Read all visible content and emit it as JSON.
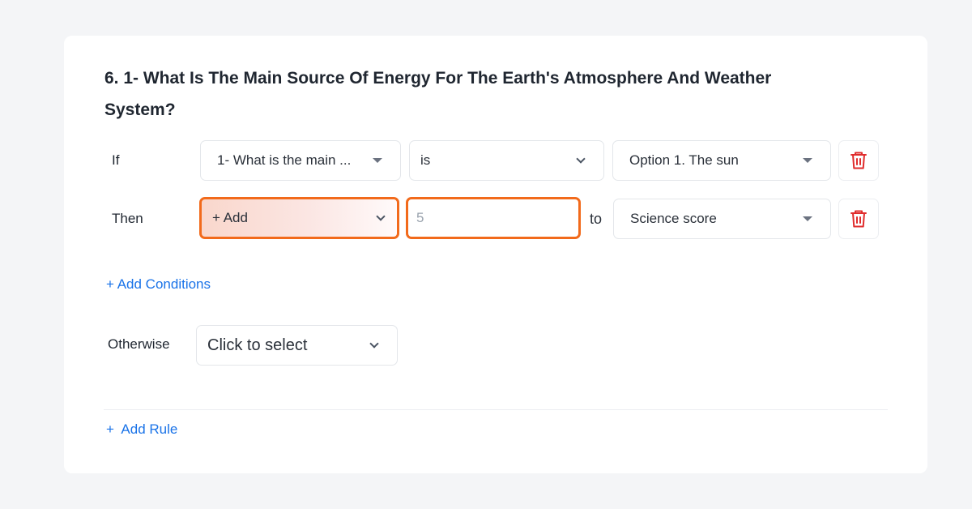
{
  "question": {
    "title": "6. 1- What Is The Main Source Of Energy For The Earth's Atmosphere And Weather System?"
  },
  "if_row": {
    "label": "If",
    "question_select": "1- What is the main ...",
    "operator_select": "is",
    "value_select": "Option 1. The sun"
  },
  "then_row": {
    "label": "Then",
    "action_select": "+ Add",
    "amount_placeholder": "5",
    "amount_value": "",
    "to_label": "to",
    "target_select": "Science score"
  },
  "add_conditions_label": "+ Add Conditions",
  "otherwise": {
    "label": "Otherwise",
    "select_value": "Click to select"
  },
  "add_rule_label": "+  Add Rule",
  "colors": {
    "accent": "#1a73e8",
    "highlight_border": "#f26a1b",
    "delete_icon": "#e02d2d"
  }
}
